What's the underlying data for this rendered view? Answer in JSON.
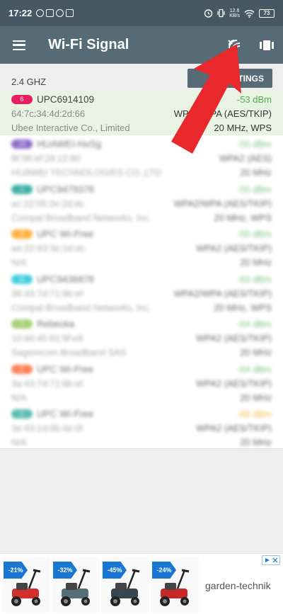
{
  "status_bar": {
    "time": "17:22",
    "battery": "73",
    "net_speed_value": "12.6",
    "net_speed_unit": "KB/s"
  },
  "app_bar": {
    "title": "Wi-Fi Signal",
    "menu_icon": "hamburger-menu-icon",
    "actions": [
      "wifi-scan-icon",
      "view-toggle-icon"
    ]
  },
  "band": {
    "label": "2.4 GHZ",
    "settings_label": "SETTINGS"
  },
  "networks": [
    {
      "channel": "6",
      "ssid": "UPC6914109",
      "dbm": "-53 dBm",
      "bssid": "64:7c:34:4d:2d:66",
      "security": "WPA2/WPA (AES/TKIP)",
      "vendor": "Ubee Interactive Co., Limited",
      "width": "20 MHz, WPS",
      "color": "#e91e63",
      "selected": true,
      "blur": false,
      "dbm_color": "#4caf50"
    },
    {
      "channel": "13",
      "ssid": "HUAWEI-HxSg",
      "dbm": "-55 dBm",
      "bssid": "f8:98:ef:29:12:80",
      "security": "WPA2 (AES)",
      "vendor": "HUAWEI TECHNOLOGIES CO.,LTD",
      "width": "20 MHz",
      "color": "#673ab7",
      "selected": false,
      "blur": true,
      "dbm_color": "#4caf50"
    },
    {
      "channel": "1",
      "ssid": "UPC9479378",
      "dbm": "-55 dBm",
      "bssid": "ac:22:05:2e:2d:dc",
      "security": "WPA2/WPA (AES/TKIP)",
      "vendor": "Compal Broadband Networks, Inc.",
      "width": "20 MHz, WPS",
      "color": "#009688",
      "selected": false,
      "blur": true,
      "dbm_color": "#4caf50"
    },
    {
      "channel": "6",
      "ssid": "UPC Wi-Free",
      "dbm": "-55 dBm",
      "bssid": "ae:22:93:3e:2d:dc",
      "security": "WPA2 (AES/TKIP)",
      "vendor": "N/A",
      "width": "20 MHz",
      "color": "#ff9800",
      "selected": false,
      "blur": true,
      "dbm_color": "#4caf50"
    },
    {
      "channel": "11",
      "ssid": "UPC9436878",
      "dbm": "-63 dBm",
      "bssid": "38:43:7d:71:8b:ef",
      "security": "WPA2/WPA (AES/TKIP)",
      "vendor": "Compal Broadband Networks, Inc.",
      "width": "20 MHz, WPS",
      "color": "#00bcd4",
      "selected": false,
      "blur": true,
      "dbm_color": "#4caf50"
    },
    {
      "channel": "1",
      "ssid": "Rebecka",
      "dbm": "-64 dBm",
      "bssid": "10:d4:45:81:9f:e8",
      "security": "WPA2 (AES/TKIP)",
      "vendor": "Sagemcom Broadband SAS",
      "width": "20 MHz",
      "color": "#8bc34a",
      "selected": false,
      "blur": true,
      "dbm_color": "#4caf50"
    },
    {
      "channel": "1",
      "ssid": "UPC Wi-Free",
      "dbm": "-64 dBm",
      "bssid": "3a:43:7d:71:8b:ef",
      "security": "WPA2 (AES/TKIP)",
      "vendor": "N/A",
      "width": "20 MHz",
      "color": "#ff5722",
      "selected": false,
      "blur": true,
      "dbm_color": "#4caf50"
    },
    {
      "channel": "1",
      "ssid": "UPC Wi-Free",
      "dbm": "-66 dBm",
      "bssid": "3e:43:1d:6b:4e:0f",
      "security": "WPA2 (AES/TKIP)",
      "vendor": "N/A",
      "width": "20 MHz",
      "color": "#26a69a",
      "selected": false,
      "blur": true,
      "dbm_color": "#f1a800"
    }
  ],
  "ad": {
    "products": [
      {
        "discount": "-21%",
        "mower_color": "#d32f2f"
      },
      {
        "discount": "-32%",
        "mower_color": "#546e7a"
      },
      {
        "discount": "-45%",
        "mower_color": "#37474f"
      },
      {
        "discount": "-24%",
        "mower_color": "#c62828"
      }
    ],
    "brand": "garden-technik",
    "choice_icon": "ad-choices-icon"
  }
}
